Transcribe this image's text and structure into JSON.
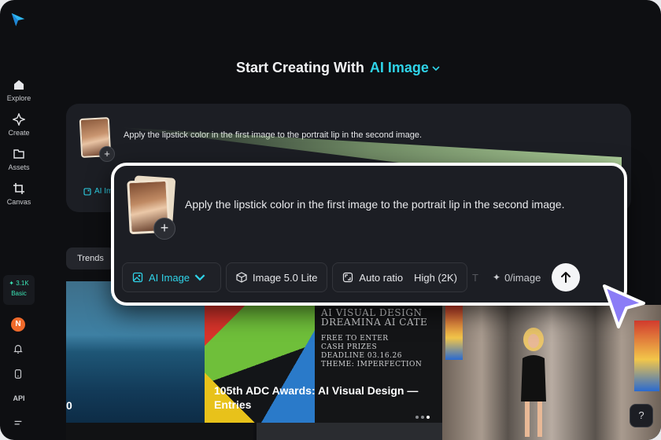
{
  "sidebar": {
    "items": [
      {
        "label": "Explore",
        "icon": "home-icon"
      },
      {
        "label": "Create",
        "icon": "sparkle-icon"
      },
      {
        "label": "Assets",
        "icon": "folder-icon"
      },
      {
        "label": "Canvas",
        "icon": "crop-icon"
      }
    ],
    "credits_count": "✦ 3.1K",
    "credits_plan": "Basic",
    "avatar_initial": "N",
    "api_label": "API"
  },
  "header": {
    "title": "Start Creating With",
    "mode": "AI Image"
  },
  "background_card": {
    "prompt": "Apply the lipstick color in the first image to the portrait lip in the second image.",
    "chip_label": "AI Im"
  },
  "prompt_card": {
    "prompt": "Apply the lipstick color in the first image to the portrait lip in the second image.",
    "add_label": "+",
    "toolbar": {
      "mode_label": "AI Image",
      "model_label": "Image 5.0 Lite",
      "ratio_label": "Auto ratio",
      "quality_label": "High (2K)",
      "cost_label": "0/image"
    }
  },
  "tabs": {
    "trends_label": "Trends"
  },
  "gallery": {
    "sea_caption": "0",
    "adc_poster_lines": [
      "AI VISUAL DESIGN",
      "DREAMINA AI CATE"
    ],
    "adc_poster_small": [
      "FREE TO ENTER",
      "CASH PRIZES",
      "DEADLINE 03.16.26",
      "THEME: IMPERFECTION"
    ],
    "adc_caption": "105th ADC Awards: AI Visual Design — Entries",
    "help_label": "?"
  },
  "colors": {
    "accent": "#2fd3e8",
    "credits": "#3be4b5",
    "avatar": "#f06a2b",
    "cursor": "#8b7cf6"
  }
}
